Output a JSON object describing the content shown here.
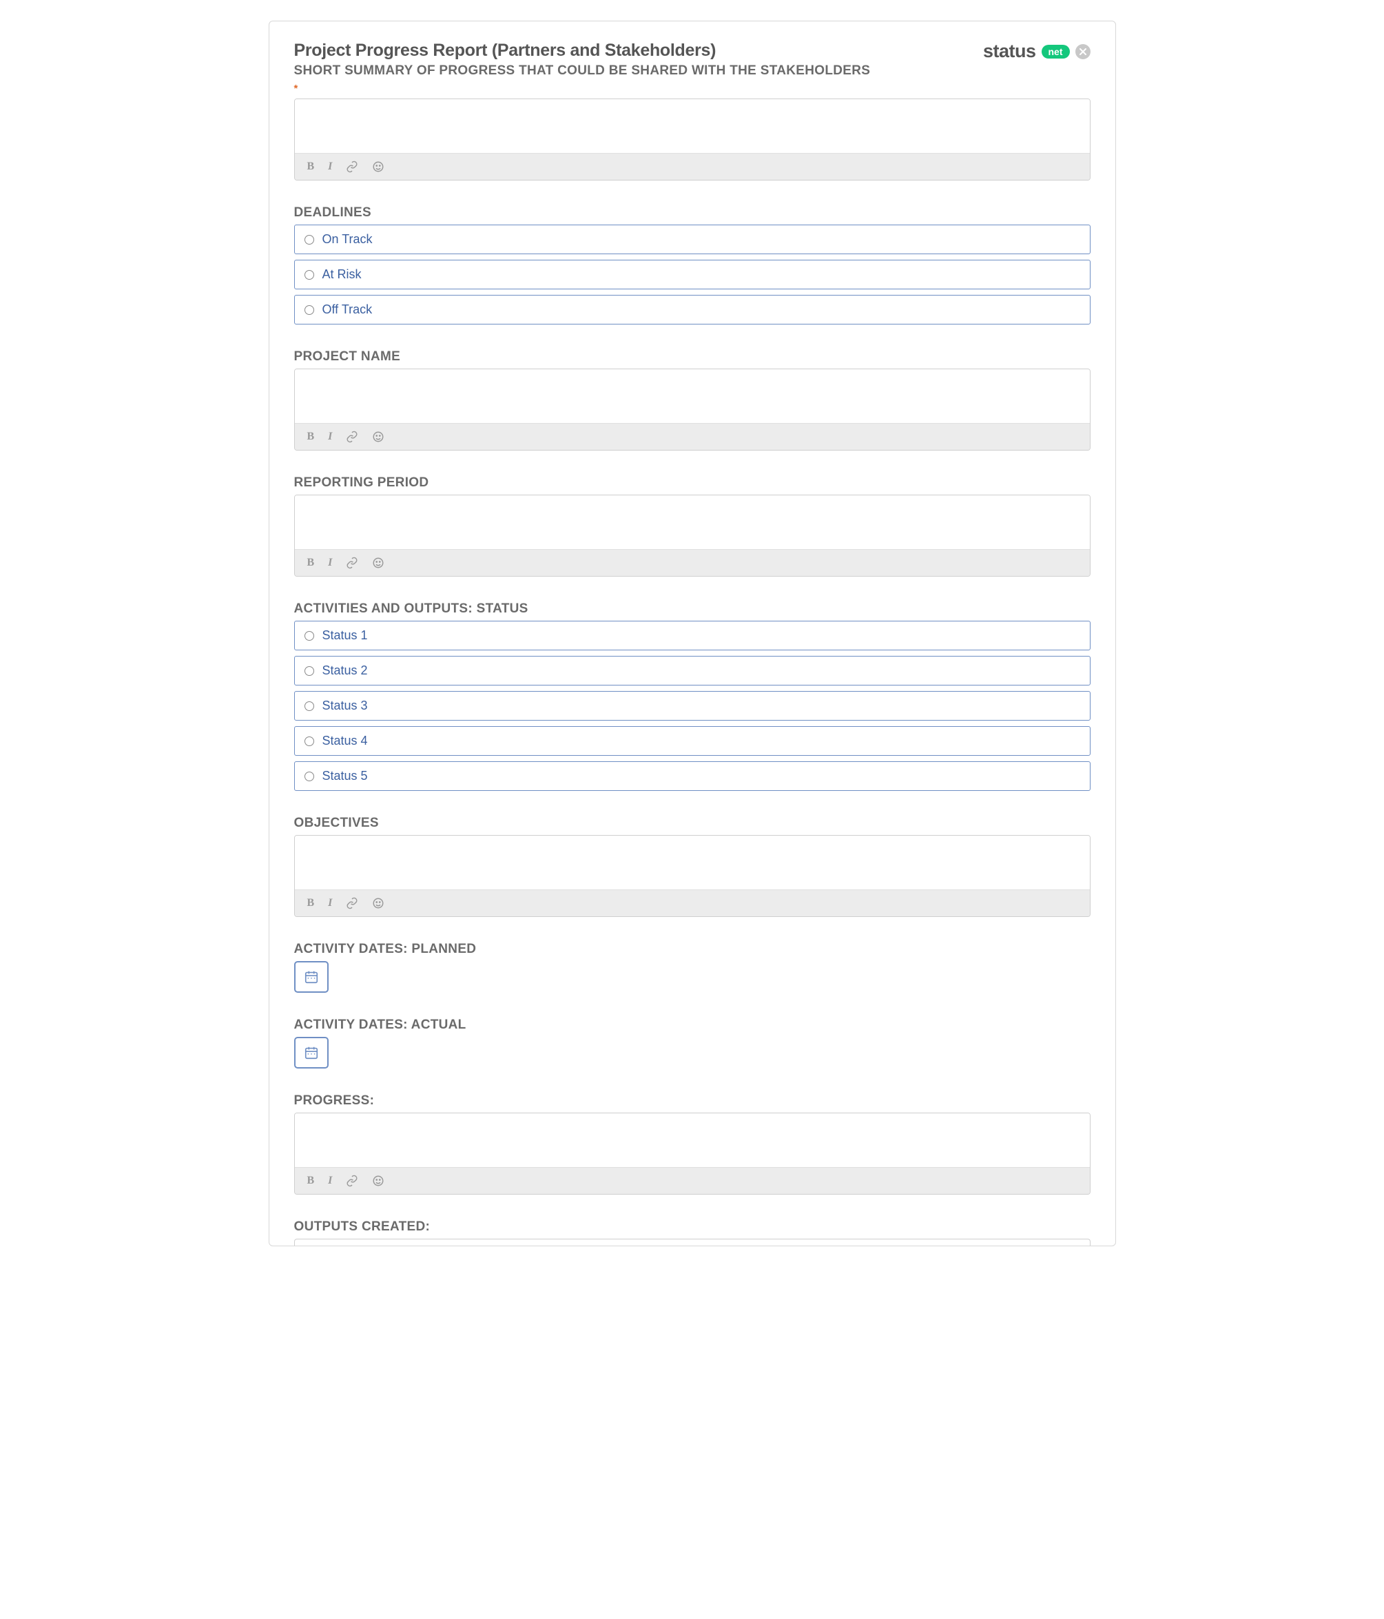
{
  "header": {
    "title": "Project Progress Report (Partners and Stakeholders)",
    "logo_text": "status",
    "logo_pill": "net"
  },
  "sections": {
    "summary_label": "SHORT SUMMARY OF PROGRESS THAT COULD BE SHARED WITH THE STAKEHOLDERS",
    "deadlines_label": "DEADLINES",
    "deadlines_options": [
      "On Track",
      "At Risk",
      "Off Track"
    ],
    "project_name_label": "PROJECT NAME",
    "reporting_period_label": "REPORTING PERIOD",
    "activities_label": "ACTIVITIES AND OUTPUTS: STATUS",
    "activities_options": [
      "Status 1",
      "Status 2",
      "Status 3",
      "Status 4",
      "Status 5"
    ],
    "objectives_label": "OBJECTIVES",
    "dates_planned_label": "ACTIVITY DATES: PLANNED",
    "dates_actual_label": "ACTIVITY DATES: ACTUAL",
    "progress_label": "PROGRESS:",
    "outputs_created_label": "OUTPUTS CREATED:"
  },
  "toolbar": {
    "bold": "B",
    "italic": "I"
  }
}
